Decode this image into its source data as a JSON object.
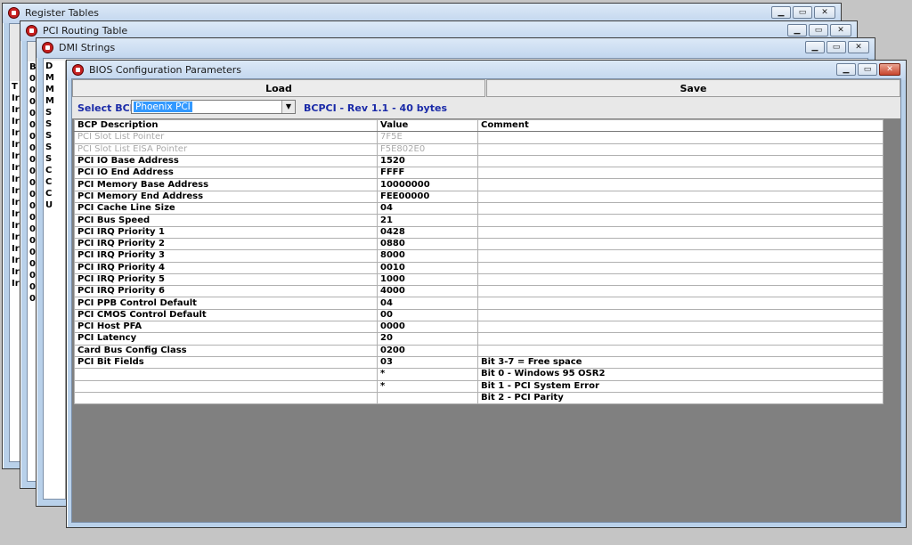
{
  "windows": {
    "register_tables": {
      "title": "Register Tables"
    },
    "pci_routing": {
      "title": "PCI Routing Table"
    },
    "dmi_strings": {
      "title": "DMI Strings"
    },
    "bios_config": {
      "title": "BIOS Configuration Parameters"
    }
  },
  "back_strips": {
    "register_tables": [
      "T",
      "Ir",
      "Ir",
      "Ir",
      "Ir",
      "Ir",
      "Ir",
      "Ir",
      "Ir",
      "Ir",
      "Ir",
      "Ir",
      "Ir",
      "Ir",
      "Ir",
      "Ir",
      "Ir",
      "Ir"
    ],
    "pci_routing": [
      "B",
      "0",
      "0",
      "0",
      "0",
      "0",
      "0",
      "0",
      "0",
      "0",
      "0",
      "0",
      "0",
      "0",
      "0",
      "0",
      "0",
      "0",
      "0",
      "0",
      "0"
    ],
    "dmi_strings": [
      "D",
      "M",
      "M",
      "M",
      "S",
      "S",
      "S",
      "S",
      "S",
      "C",
      "C",
      "C",
      "U"
    ]
  },
  "toolbar": {
    "load_label": "Load",
    "save_label": "Save"
  },
  "select": {
    "label": "Select BCP:",
    "value": "Phoenix PCI",
    "info": "BCPCI  - Rev 1.1 - 40 bytes"
  },
  "table": {
    "headers": [
      "BCP Description",
      "Value",
      "Comment"
    ],
    "rows": [
      {
        "desc": "PCI Slot List Pointer",
        "value": "7F5E",
        "comment": "",
        "dim": true
      },
      {
        "desc": "PCI Slot List EISA Pointer",
        "value": "F5E802E0",
        "comment": "",
        "dim": true
      },
      {
        "desc": "PCI IO Base Address",
        "value": "1520",
        "comment": ""
      },
      {
        "desc": "PCI IO End Address",
        "value": "FFFF",
        "comment": ""
      },
      {
        "desc": "PCI Memory Base Address",
        "value": "10000000",
        "comment": ""
      },
      {
        "desc": "PCI Memory End Address",
        "value": "FEE00000",
        "comment": ""
      },
      {
        "desc": "PCI Cache Line Size",
        "value": "04",
        "comment": ""
      },
      {
        "desc": "PCI Bus Speed",
        "value": "21",
        "comment": ""
      },
      {
        "desc": "PCI IRQ Priority 1",
        "value": "0428",
        "comment": ""
      },
      {
        "desc": "PCI IRQ Priority 2",
        "value": "0880",
        "comment": ""
      },
      {
        "desc": "PCI IRQ Priority 3",
        "value": "8000",
        "comment": ""
      },
      {
        "desc": "PCI IRQ Priority 4",
        "value": "0010",
        "comment": ""
      },
      {
        "desc": "PCI IRQ Priority 5",
        "value": "1000",
        "comment": ""
      },
      {
        "desc": "PCI IRQ Priority 6",
        "value": "4000",
        "comment": ""
      },
      {
        "desc": "PCI PPB Control Default",
        "value": "04",
        "comment": ""
      },
      {
        "desc": "PCI CMOS Control Default",
        "value": "00",
        "comment": ""
      },
      {
        "desc": "PCI Host PFA",
        "value": "0000",
        "comment": ""
      },
      {
        "desc": "PCI Latency",
        "value": "20",
        "comment": ""
      },
      {
        "desc": "Card Bus Config Class",
        "value": "0200",
        "comment": ""
      },
      {
        "desc": "PCI Bit Fields",
        "value": "03",
        "comment": "Bit 3-7 = Free space"
      },
      {
        "desc": "",
        "value": "*",
        "comment": "Bit 0 - Windows 95 OSR2"
      },
      {
        "desc": "",
        "value": "*",
        "comment": "Bit 1 - PCI System Error"
      },
      {
        "desc": "",
        "value": "",
        "comment": "Bit 2 - PCI Parity"
      }
    ]
  },
  "icons": {
    "app": "phoenix-app-icon",
    "minimize": "minimize-icon",
    "maximize": "maximize-icon",
    "close": "close-icon",
    "dropdown": "chevron-down-icon"
  },
  "colors": {
    "accent_text": "#1a2aa8",
    "selection": "#3399ff",
    "grid_bg": "#808080"
  }
}
